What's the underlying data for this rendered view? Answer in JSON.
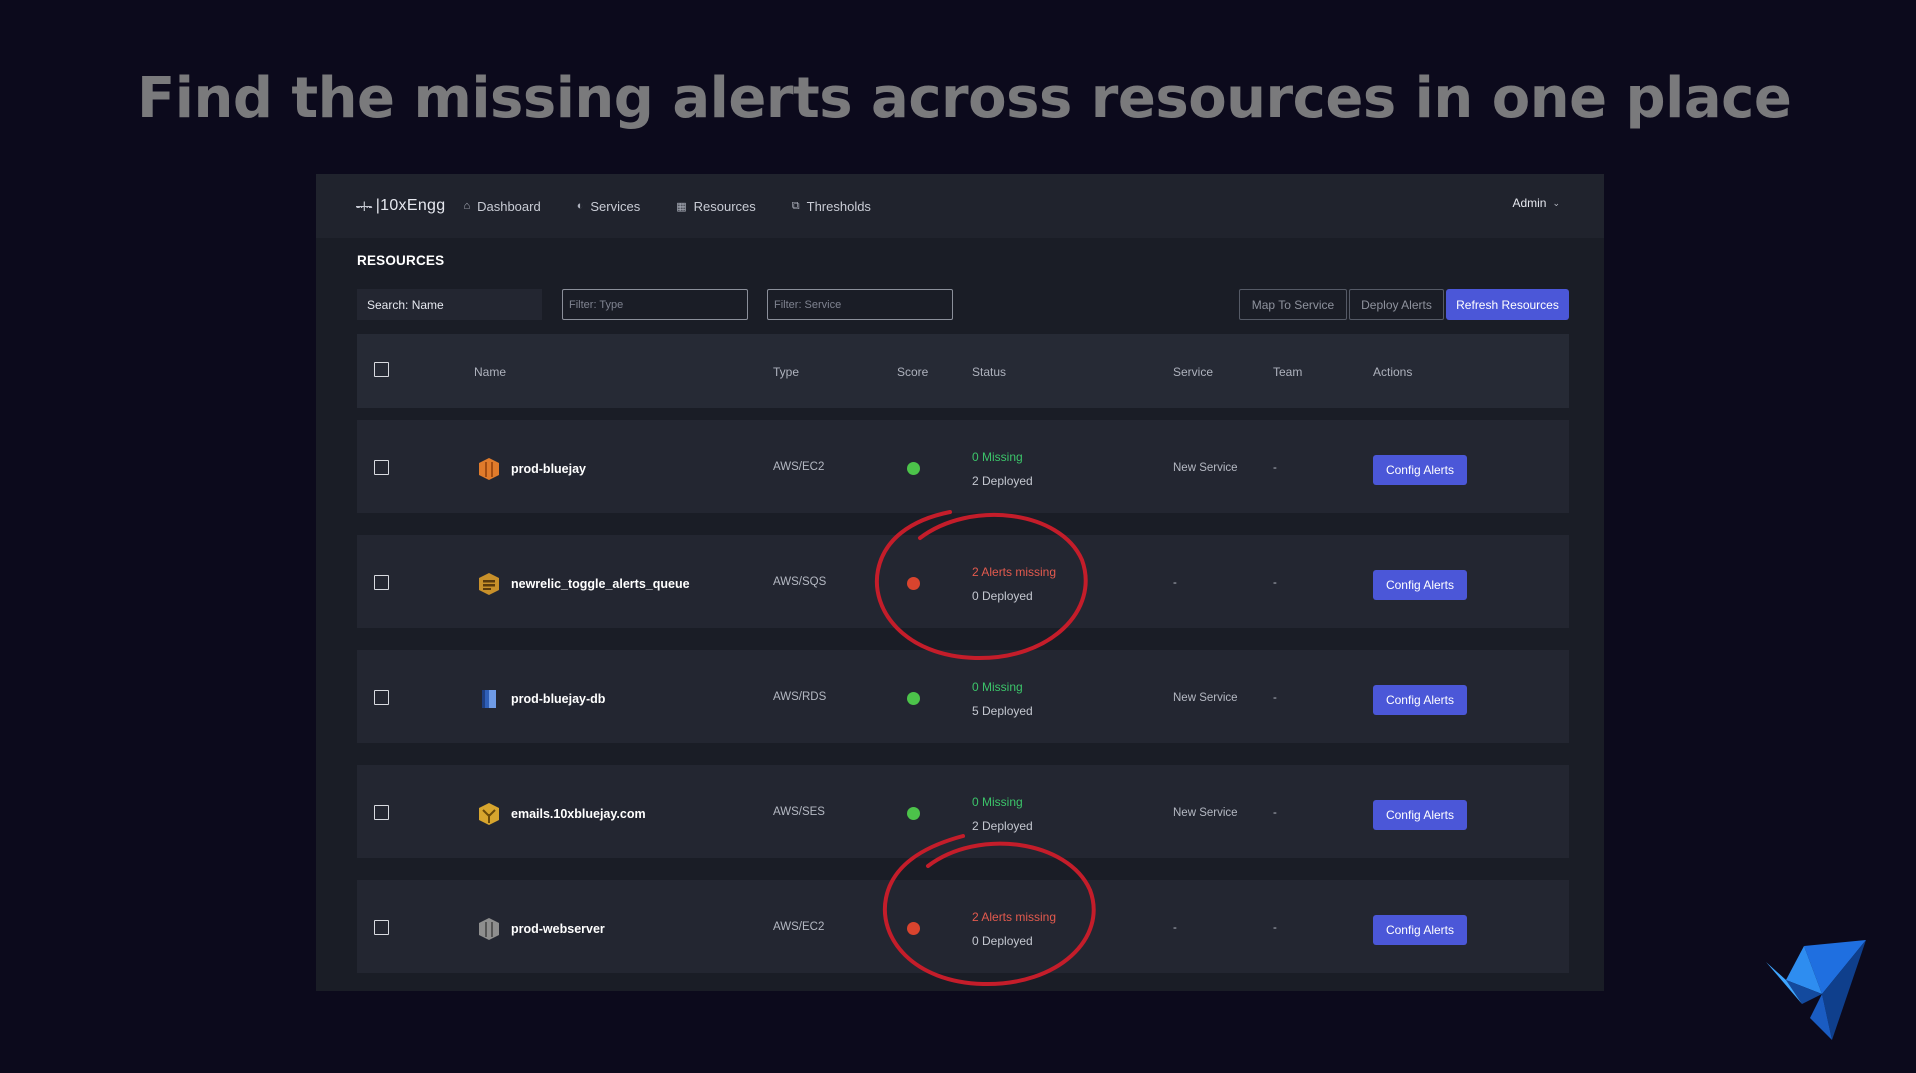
{
  "headline": "Find the missing alerts across resources in one place",
  "app": {
    "logo_mark": "-·ǀ·-",
    "logo_text": "|10xEngg",
    "nav": [
      {
        "label": "Dashboard",
        "icon": "home-icon"
      },
      {
        "label": "Services",
        "icon": "circle-icon"
      },
      {
        "label": "Resources",
        "icon": "grid-icon"
      },
      {
        "label": "Thresholds",
        "icon": "copy-icon"
      }
    ],
    "user_menu": "Admin"
  },
  "page": {
    "title": "RESOURCES",
    "search_placeholder": "Search: Name",
    "filter_type_placeholder": "Filter: Type",
    "filter_service_placeholder": "Filter: Service",
    "map_to_service_label": "Map To Service",
    "deploy_alerts_label": "Deploy Alerts",
    "refresh_resources_label": "Refresh Resources"
  },
  "table": {
    "columns": [
      "Name",
      "Type",
      "Score",
      "Status",
      "Service",
      "Team",
      "Actions"
    ],
    "rows": [
      {
        "name": "prod-bluejay",
        "type": "AWS/EC2",
        "score": "green",
        "status_primary": "0 Missing",
        "status_secondary": "2 Deployed",
        "service": "New Service",
        "team": "-",
        "action": "Config Alerts",
        "icon_color": "#e07b2b"
      },
      {
        "name": "newrelic_toggle_alerts_queue",
        "type": "AWS/SQS",
        "score": "red",
        "status_primary": "2 Alerts missing",
        "status_secondary": "0 Deployed",
        "service": "-",
        "team": "-",
        "action": "Config Alerts",
        "icon_color": "#c8902a"
      },
      {
        "name": "prod-bluejay-db",
        "type": "AWS/RDS",
        "score": "green",
        "status_primary": "0 Missing",
        "status_secondary": "5 Deployed",
        "service": "New Service",
        "team": "-",
        "action": "Config Alerts",
        "icon_color": "#2f5fb8"
      },
      {
        "name": "emails.10xbluejay.com",
        "type": "AWS/SES",
        "score": "green",
        "status_primary": "0 Missing",
        "status_secondary": "2 Deployed",
        "service": "New Service",
        "team": "-",
        "action": "Config Alerts",
        "icon_color": "#d7a52e"
      },
      {
        "name": "prod-webserver",
        "type": "AWS/EC2",
        "score": "red",
        "status_primary": "2 Alerts missing",
        "status_secondary": "0 Deployed",
        "service": "-",
        "team": "-",
        "action": "Config Alerts",
        "icon_color": "#8e8e8e"
      }
    ]
  },
  "colors": {
    "ok": "#3cc46a",
    "ok_dot": "#4cc34a",
    "missing": "#e35a4e",
    "missing_dot": "#d9442e",
    "accent": "#4b57d8",
    "annotation": "#c41d2a"
  }
}
